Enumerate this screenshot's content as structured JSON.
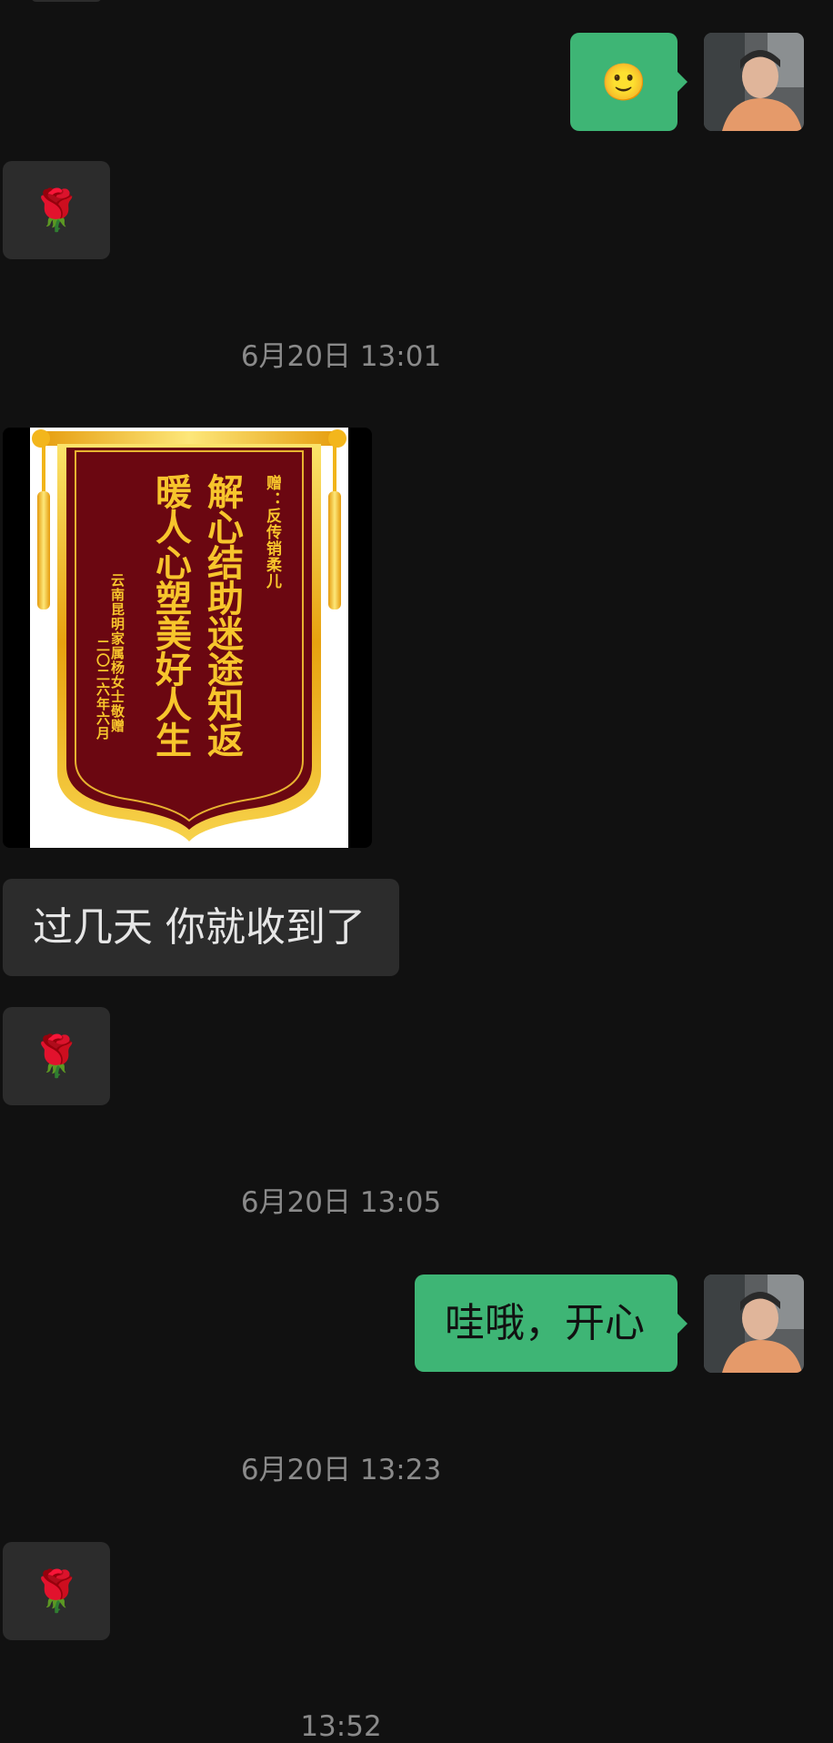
{
  "messages": {
    "timestamps": [
      "6月20日 13:01",
      "6月20日 13:05",
      "6月20日 13:23",
      "13:52"
    ],
    "text_incoming": "过几天 你就收到了",
    "text_outgoing": "哇哦，开心",
    "emoji_rose": "🌹",
    "emoji_top": "🙂"
  },
  "banner": {
    "dedication": "赠：反传销柔儿",
    "line1": "解心结助迷途知返",
    "line2": "暖人心塑美好人生",
    "giver": "云南昆明家属杨女士敬赠",
    "date": "二〇二六年六月"
  },
  "colors": {
    "background": "#111111",
    "incoming_bubble": "#2c2c2c",
    "outgoing_bubble": "#3eb575",
    "banner_red": "#6b0711",
    "banner_gold": "#f7c52c"
  }
}
